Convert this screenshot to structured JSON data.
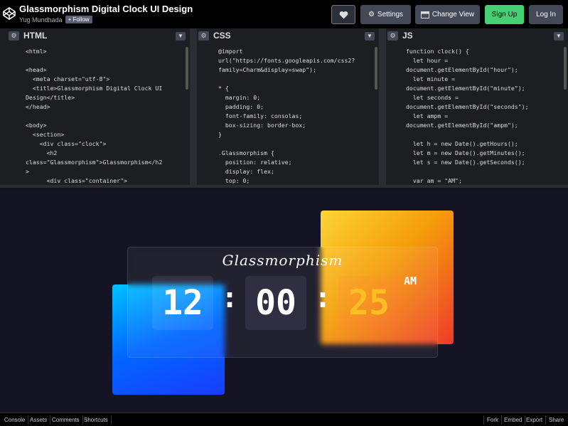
{
  "header": {
    "title": "Glassmorphism Digital Clock UI Design",
    "author": "Yug Mundhada",
    "follow_label": "+ Follow",
    "buttons": {
      "heart_icon": "heart-icon",
      "settings": "Settings",
      "change_view": "Change View",
      "sign_up": "Sign Up",
      "log_in": "Log In"
    }
  },
  "editors": {
    "html": {
      "title": "HTML",
      "lines": [
        "<html>",
        "",
        "<head>",
        "  <meta charset=\"utf-8\">",
        "  <title>Glassmorphism Digital Clock UI",
        "Design</title>",
        "</head>",
        "",
        "<body>",
        "  <section>",
        "    <div class=\"clock\">",
        "      <h2",
        "class=\"Glassmorphism\">Glassmorphism</h2",
        ">",
        "      <div class=\"container\">"
      ]
    },
    "css": {
      "title": "CSS",
      "lines": [
        "@import",
        "url(\"https://fonts.googleapis.com/css2?",
        "family=Charm&display=swap\");",
        "",
        "* {",
        "  margin: 0;",
        "  padding: 0;",
        "  font-family: consolas;",
        "  box-sizing: border-box;",
        "}",
        "",
        ".Glassmorphism {",
        "  position: relative;",
        "  display: flex;",
        "  top: 0;"
      ]
    },
    "js": {
      "title": "JS",
      "lines": [
        "function clock() {",
        "  let hour =",
        "document.getElementById(\"hour\");",
        "  let minute =",
        "document.getElementById(\"minute\");",
        "  let seconds =",
        "document.getElementById(\"seconds\");",
        "  let ampm =",
        "document.getElementById(\"ampm\");",
        "",
        "  let h = new Date().getHours();",
        "  let m = new Date().getMinutes();",
        "  let s = new Date().getSeconds();",
        "",
        "  var am = \"AM\";"
      ]
    }
  },
  "preview": {
    "clock_title": "Glassmorphism",
    "hour": "12",
    "minute": "00",
    "seconds": "25",
    "ampm": "AM",
    "colon": ":"
  },
  "footer": {
    "left": [
      "Console",
      "Assets",
      "Comments",
      "Shortcuts"
    ],
    "right": [
      "Fork",
      "Embed",
      "Export",
      "Share"
    ]
  },
  "colors": {
    "signup": "#47cf73",
    "orange_square": "#f59e0b",
    "blue_square": "#0066ff",
    "seconds_text": "#fbbf24"
  }
}
